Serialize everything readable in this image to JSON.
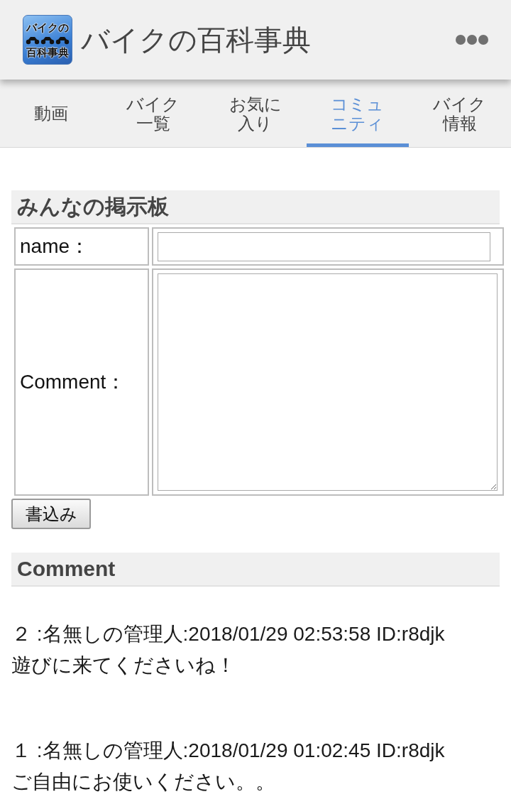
{
  "app_bar": {
    "logo_text": [
      "バイクの",
      "百科事典"
    ],
    "title": "バイクの百科事典"
  },
  "tabs": [
    {
      "label": "動画",
      "selected": false
    },
    {
      "label": "バイク一覧",
      "selected": false
    },
    {
      "label": "お気に入り",
      "selected": false
    },
    {
      "label": "コミュニティ",
      "selected": true
    },
    {
      "label": "バイク情報",
      "selected": false
    }
  ],
  "board": {
    "heading": "みんなの掲示板",
    "fields": [
      {
        "kind": "input",
        "label": "name："
      },
      {
        "kind": "textarea",
        "label": "Comment："
      }
    ],
    "submit": "書込み"
  },
  "comments": {
    "heading": "Comment",
    "posts": [
      {
        "header": "２ :名無しの管理人:2018/01/29 02:53:58 ID:r8djk",
        "body": "遊びに来てくださいね！"
      },
      {
        "header": "１ :名無しの管理人:2018/01/29 01:02:45 ID:r8djk",
        "body": "ご自由にお使いください。。"
      }
    ]
  }
}
